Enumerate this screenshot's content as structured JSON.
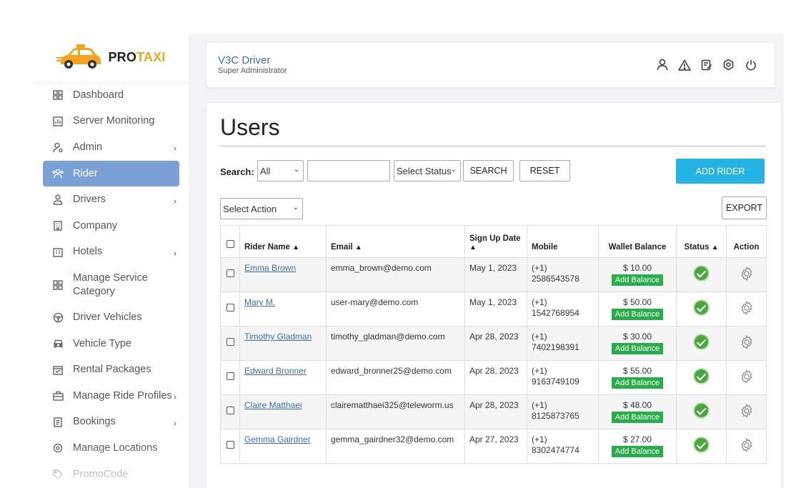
{
  "brand": {
    "name_part1": "PRO",
    "name_part2": "TAXI",
    "accent": "#f5a31a"
  },
  "sidebar": {
    "items": [
      {
        "label": "Dashboard",
        "icon": "dashboard-icon"
      },
      {
        "label": "Server Monitoring",
        "icon": "chart-icon"
      },
      {
        "label": "Admin",
        "icon": "user-cog-icon",
        "expandable": true
      },
      {
        "label": "Rider",
        "icon": "users-icon",
        "active": true
      },
      {
        "label": "Drivers",
        "icon": "user-icon",
        "expandable": true
      },
      {
        "label": "Company",
        "icon": "building-icon"
      },
      {
        "label": "Hotels",
        "icon": "hotel-icon",
        "expandable": true
      },
      {
        "label": "Manage Service Category",
        "icon": "grid-icon"
      },
      {
        "label": "Driver Vehicles",
        "icon": "steering-wheel-icon"
      },
      {
        "label": "Vehicle Type",
        "icon": "car-icon"
      },
      {
        "label": "Rental Packages",
        "icon": "calendar-icon"
      },
      {
        "label": "Manage Ride Profiles",
        "icon": "briefcase-icon",
        "expandable": true
      },
      {
        "label": "Bookings",
        "icon": "list-icon",
        "expandable": true
      },
      {
        "label": "Manage Locations",
        "icon": "location-icon"
      },
      {
        "label": "PromoCode",
        "icon": "tag-icon"
      }
    ]
  },
  "header": {
    "title": "V3C Driver",
    "subtitle": "Super Administrator",
    "icons": [
      "profile-icon",
      "warning-icon",
      "edit-icon",
      "settings-icon",
      "power-icon"
    ]
  },
  "page": {
    "title": "Users",
    "search_label": "Search:",
    "filter_select": "All",
    "search_input_value": "",
    "status_select": "Select Status",
    "search_button": "SEARCH",
    "reset_button": "RESET",
    "add_button": "ADD RIDER",
    "action_select": "Select Action",
    "export_button": "EXPORT"
  },
  "table": {
    "columns": {
      "name": "Rider Name",
      "email": "Email",
      "signup": "Sign Up Date",
      "mobile": "Mobile",
      "wallet": "Wallet Balance",
      "status": "Status",
      "action": "Action"
    },
    "add_balance_label": "Add Balance",
    "rows": [
      {
        "name": "Emma Brown",
        "email": "emma_brown@demo.com",
        "signup": "May 1, 2023",
        "mobile": "(+1) 2586543578",
        "wallet": "$ 10.00"
      },
      {
        "name": "Mary M.",
        "email": "user-mary@demo.com",
        "signup": "May 1, 2023",
        "mobile": "(+1) 1542768954",
        "wallet": "$ 50.00"
      },
      {
        "name": "Timothy Gladman",
        "email": "timothy_gladman@demo.com",
        "signup": "Apr 28, 2023",
        "mobile": "(+1) 7402198391",
        "wallet": "$ 30.00"
      },
      {
        "name": "Edward Bronner",
        "email": "edward_bronner25@demo.com",
        "signup": "Apr 28, 2023",
        "mobile": "(+1) 9163749109",
        "wallet": "$ 55.00"
      },
      {
        "name": "Claire Matthaei",
        "email": "clairematthaei325@teleworm.us",
        "signup": "Apr 28, 2023",
        "mobile": "(+1) 8125873765",
        "wallet": "$ 48.00"
      },
      {
        "name": "Gemma Gairdner",
        "email": "gemma_gairdner32@demo.com",
        "signup": "Apr 27, 2023",
        "mobile": "(+1) 8302474774",
        "wallet": "$ 27.00"
      }
    ]
  }
}
